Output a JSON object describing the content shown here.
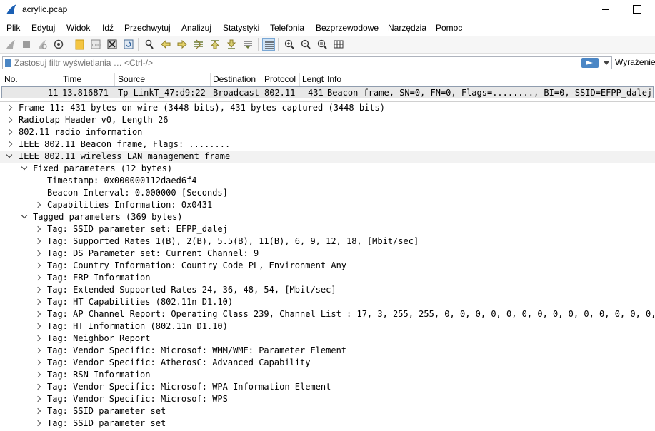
{
  "window": {
    "title": "acrylic.pcap"
  },
  "menu": [
    "Plik",
    "Edytuj",
    "Widok",
    "Idź",
    "Przechwytuj",
    "Analizuj",
    "Statystyki",
    "Telefonia",
    "Bezprzewodowe",
    "Narzędzia",
    "Pomoc"
  ],
  "filter": {
    "placeholder": "Zastosuj filtr wyświetlania … <Ctrl-/>",
    "expression_label": "Wyrażenie."
  },
  "packet_list": {
    "columns": [
      "No.",
      "Time",
      "Source",
      "Destination",
      "Protocol",
      "Lengt",
      "Info"
    ],
    "rows": [
      {
        "no": "11",
        "time": "13.816871",
        "source": "Tp-LinkT_47:d9:22",
        "destination": "Broadcast",
        "protocol": "802.11",
        "length": "431",
        "info": "Beacon frame, SN=0, FN=0, Flags=........, BI=0, SSID=EFPP_dalej"
      }
    ]
  },
  "details": [
    {
      "text": "Frame 11: 431 bytes on wire (3448 bits), 431 bytes captured (3448 bits)",
      "level": 0,
      "state": "collapsed"
    },
    {
      "text": "Radiotap Header v0, Length 26",
      "level": 0,
      "state": "collapsed"
    },
    {
      "text": "802.11 radio information",
      "level": 0,
      "state": "collapsed"
    },
    {
      "text": "IEEE 802.11 Beacon frame, Flags: ........",
      "level": 0,
      "state": "collapsed"
    },
    {
      "text": "IEEE 802.11 wireless LAN management frame",
      "level": 0,
      "state": "expanded"
    },
    {
      "text": "Fixed parameters (12 bytes)",
      "level": 1,
      "state": "expanded"
    },
    {
      "text": "Timestamp: 0x000000112daed6f4",
      "level": 2,
      "state": "leaf"
    },
    {
      "text": "Beacon Interval: 0.000000 [Seconds]",
      "level": 2,
      "state": "leaf"
    },
    {
      "text": "Capabilities Information: 0x0431",
      "level": 2,
      "state": "collapsed"
    },
    {
      "text": "Tagged parameters (369 bytes)",
      "level": 1,
      "state": "expanded"
    },
    {
      "text": "Tag: SSID parameter set: EFPP_dalej",
      "level": 2,
      "state": "collapsed"
    },
    {
      "text": "Tag: Supported Rates 1(B), 2(B), 5.5(B), 11(B), 6, 9, 12, 18, [Mbit/sec]",
      "level": 2,
      "state": "collapsed"
    },
    {
      "text": "Tag: DS Parameter set: Current Channel: 9",
      "level": 2,
      "state": "collapsed"
    },
    {
      "text": "Tag: Country Information: Country Code PL, Environment Any",
      "level": 2,
      "state": "collapsed"
    },
    {
      "text": "Tag: ERP Information",
      "level": 2,
      "state": "collapsed"
    },
    {
      "text": "Tag: Extended Supported Rates 24, 36, 48, 54, [Mbit/sec]",
      "level": 2,
      "state": "collapsed"
    },
    {
      "text": "Tag: HT Capabilities (802.11n D1.10)",
      "level": 2,
      "state": "collapsed"
    },
    {
      "text": "Tag: AP Channel Report: Operating Class 239, Channel List : 17, 3, 255, 255, 0, 0, 0, 0, 0, 0, 0, 0, 0, 0, 0, 0, 0, 0, 0,",
      "level": 2,
      "state": "collapsed"
    },
    {
      "text": "Tag: HT Information (802.11n D1.10)",
      "level": 2,
      "state": "collapsed"
    },
    {
      "text": "Tag: Neighbor Report",
      "level": 2,
      "state": "collapsed"
    },
    {
      "text": "Tag: Vendor Specific: Microsof: WMM/WME: Parameter Element",
      "level": 2,
      "state": "collapsed"
    },
    {
      "text": "Tag: Vendor Specific: AtherosC: Advanced Capability",
      "level": 2,
      "state": "collapsed"
    },
    {
      "text": "Tag: RSN Information",
      "level": 2,
      "state": "collapsed"
    },
    {
      "text": "Tag: Vendor Specific: Microsof: WPA Information Element",
      "level": 2,
      "state": "collapsed"
    },
    {
      "text": "Tag: Vendor Specific: Microsof: WPS",
      "level": 2,
      "state": "collapsed"
    },
    {
      "text": "Tag: SSID parameter set",
      "level": 2,
      "state": "collapsed"
    },
    {
      "text": "Tag: SSID parameter set",
      "level": 2,
      "state": "collapsed"
    }
  ],
  "colors": {
    "accent": "#4a86c5",
    "selected_packet": "#e8e8e8"
  }
}
